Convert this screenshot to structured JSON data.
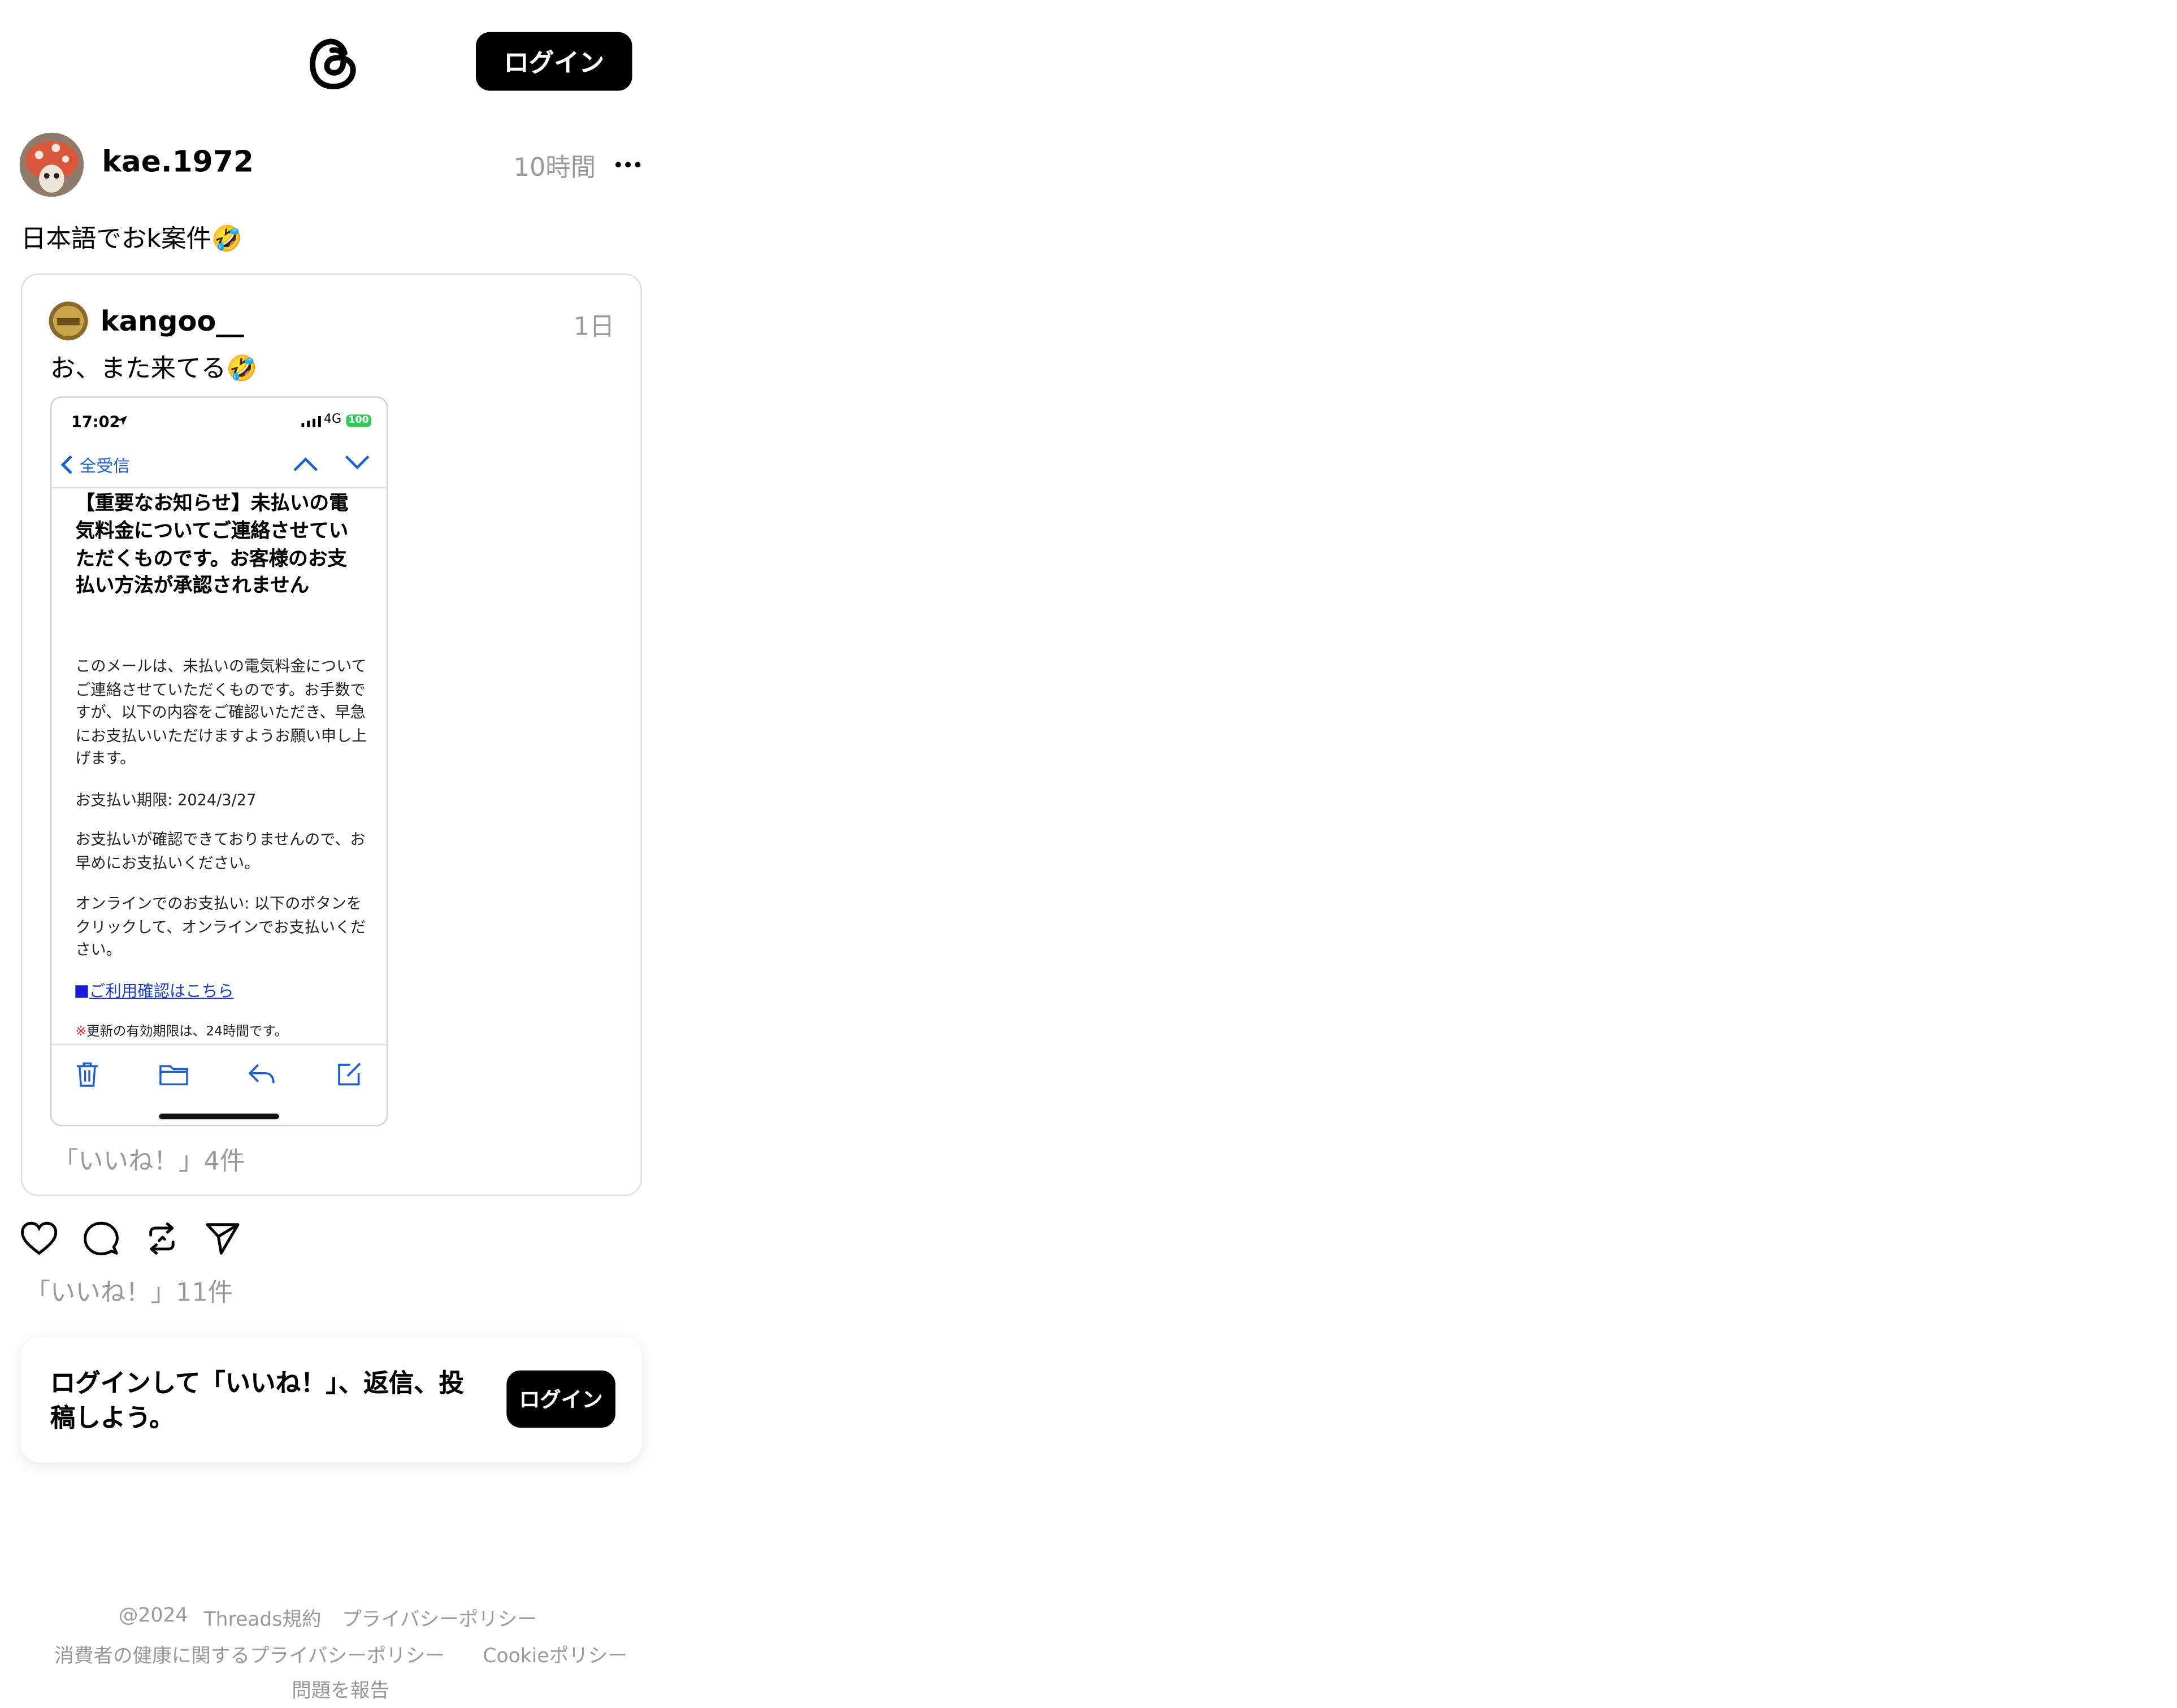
{
  "header": {
    "login_label": "ログイン"
  },
  "post": {
    "username": "kae.1972",
    "time": "10時間",
    "text": "日本語でおk案件🤣",
    "likes": "「いいね！」11件"
  },
  "quoted": {
    "username": "kangoo__",
    "time": "1日",
    "text": "お、また来てる🤣",
    "likes": "「いいね！」4件"
  },
  "phone": {
    "status_time": "17:02",
    "network": "4G",
    "battery": "100",
    "back_label": "全受信",
    "subject": "【重要なお知らせ】未払いの電気料金についてご連絡させていただくものです。お客様のお支払い方法が承認されません",
    "body_1": "このメールは、未払いの電気料金についてご連絡させていただくものです。お手数ですが、以下の内容をご確認いただき、早急にお支払いいただけますようお願い申し上げます。",
    "body_2": "お支払い期限: 2024/3/27",
    "body_3": "お支払いが確認できておりませんので、お早めにお支払いください。",
    "body_4": "オンラインでのお支払い: 以下のボタンをクリックして、オンラインでお支払いください。",
    "link": "ご利用確認はこちら",
    "note_mark": "※",
    "note": "更新の有効期限は、24時間です。"
  },
  "prompt": {
    "text": "ログインして「いいね！」、返信、投稿しよう。",
    "login_label": "ログイン"
  },
  "footer": {
    "copyright": "@2024",
    "terms": "Threads規約",
    "privacy": "プライバシーポリシー",
    "health_privacy": "消費者の健康に関するプライバシーポリシー",
    "cookie": "Cookieポリシー",
    "report": "問題を報告"
  },
  "icons": [
    "threads-logo-icon",
    "more-icon",
    "heart-icon",
    "comment-icon",
    "repost-icon",
    "share-icon",
    "trash-icon",
    "folder-icon",
    "reply-icon",
    "compose-icon"
  ],
  "colors": {
    "accent": "#000000",
    "muted": "#999999",
    "link": "#1a5fd4",
    "battery": "#34c759"
  }
}
